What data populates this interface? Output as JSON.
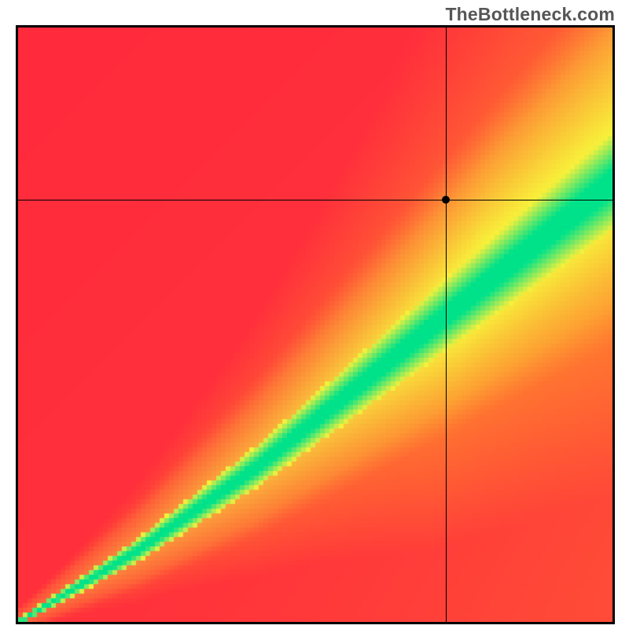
{
  "watermark": "TheBottleneck.com",
  "chart_data": {
    "type": "heatmap",
    "title": "",
    "xlabel": "",
    "ylabel": "",
    "xlim": [
      0,
      100
    ],
    "ylim": [
      0,
      100
    ],
    "crosshair": {
      "x": 72,
      "y": 71
    },
    "marker": {
      "x": 72,
      "y": 71
    },
    "optimal_band": {
      "description": "green optimal band along diagonal from bottom-left to upper-right",
      "points_center": [
        {
          "x": 0,
          "y": 0
        },
        {
          "x": 20,
          "y": 12
        },
        {
          "x": 40,
          "y": 26
        },
        {
          "x": 60,
          "y": 42
        },
        {
          "x": 80,
          "y": 58
        },
        {
          "x": 100,
          "y": 74
        }
      ],
      "band_halfwidth": 6
    },
    "color_stops": {
      "best": "#00e28a",
      "good": "#f8f03a",
      "mid": "#ff9a2a",
      "bad": "#ff2a3c"
    }
  }
}
